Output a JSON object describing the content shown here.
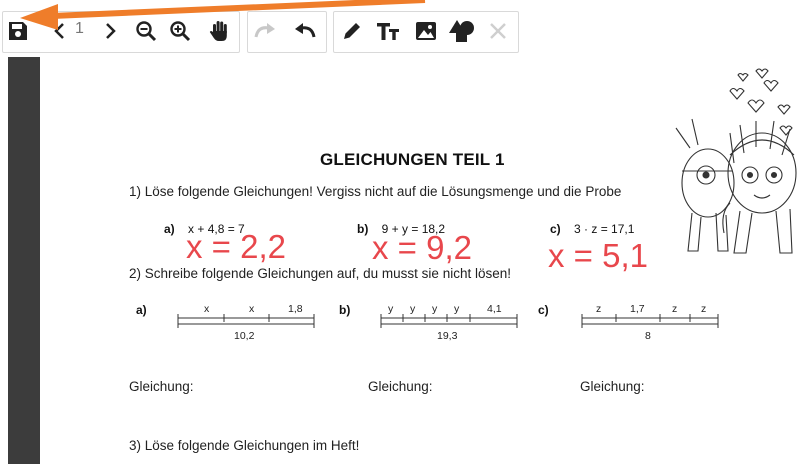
{
  "toolbar": {
    "icons": [
      "save-icon",
      "prev-page-icon",
      "next-page-icon",
      "zoom-out-icon",
      "zoom-in-icon",
      "hand-icon",
      "redo-icon",
      "undo-icon",
      "pencil-icon",
      "text-size-icon",
      "image-icon",
      "shapes-icon",
      "close-icon"
    ],
    "page_number": "1"
  },
  "annotation": {
    "arrow_color": "#ef7d2a"
  },
  "worksheet": {
    "title": "GLEICHUNGEN TEIL 1",
    "task1": "1) Löse folgende Gleichungen! Vergiss nicht auf die Lösungsmenge und die Probe",
    "eq_a_label": "a)",
    "eq_a": "x + 4,8 = 7",
    "eq_b_label": "b)",
    "eq_b": "9 + y = 18,2",
    "eq_c_label": "c)",
    "eq_c": "3 · z = 17,1",
    "ans_a": "x = 2,2",
    "ans_b": "x = 9,2",
    "ans_c": "x = 5,1",
    "task2": "2) Schreibe folgende Gleichungen auf, du musst sie nicht lösen!",
    "bar_a_label": "a)",
    "bar_b_label": "b)",
    "bar_c_label": "c)",
    "bar_a_top": [
      "x",
      "x",
      "1,8"
    ],
    "bar_a_total": "10,2",
    "bar_b_top": [
      "y",
      "y",
      "y",
      "y",
      "4,1"
    ],
    "bar_b_total": "19,3",
    "bar_c_top": [
      "z",
      "1,7",
      "z",
      "z"
    ],
    "bar_c_total": "8",
    "gleichung": "Gleichung:",
    "task3": "3) Löse folgende Gleichungen im Heft!"
  },
  "colors": {
    "handwriting": "#e8474c",
    "sidebar": "#3c3c3c"
  }
}
